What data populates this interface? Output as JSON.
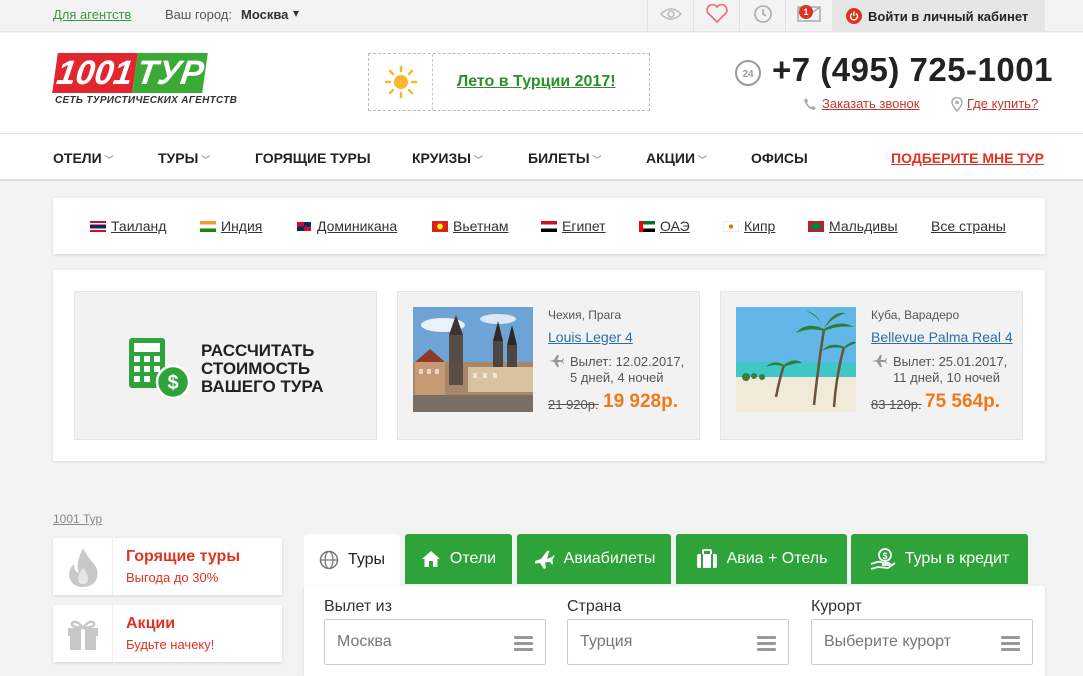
{
  "topbar": {
    "agency_link": "Для агентств",
    "city_label": "Ваш город:",
    "city": "Москва",
    "city_arrow": "▾",
    "messages_count": "1",
    "login": "Войти в личный кабинет"
  },
  "header": {
    "logo_main_1": "1001",
    "logo_main_2": "ТУР",
    "logo_sub": "СЕТЬ ТУРИСТИЧЕСКИХ АГЕНТСТВ",
    "promo": "Лето в Турции 2017!",
    "phone": "+7 (495) 725-1001",
    "callback": "Заказать звонок",
    "where_to_buy": "Где купить?"
  },
  "menu": {
    "items": [
      {
        "label": "ОТЕЛИ",
        "dropdown": true
      },
      {
        "label": "ТУРЫ",
        "dropdown": true
      },
      {
        "label": "ГОРЯЩИЕ ТУРЫ",
        "dropdown": false
      },
      {
        "label": "КРУИЗЫ",
        "dropdown": true
      },
      {
        "label": "БИЛЕТЫ",
        "dropdown": true
      },
      {
        "label": "АКЦИИ",
        "dropdown": true
      },
      {
        "label": "ОФИСЫ",
        "dropdown": false
      }
    ],
    "cta": "ПОДБЕРИТЕ МНЕ ТУР"
  },
  "countries": [
    {
      "label": "Таиланд",
      "flag": "flag-thailand-icon"
    },
    {
      "label": "Индия",
      "flag": "flag-india-icon"
    },
    {
      "label": "Доминикана",
      "flag": "flag-dominicana-icon"
    },
    {
      "label": "Вьетнам",
      "flag": "flag-vietnam-icon"
    },
    {
      "label": "Египет",
      "flag": "flag-egypt-icon"
    },
    {
      "label": "ОАЭ",
      "flag": "flag-uae-icon"
    },
    {
      "label": "Кипр",
      "flag": "flag-cyprus-icon"
    },
    {
      "label": "Мальдивы",
      "flag": "flag-maldives-icon"
    },
    {
      "label": "Все страны",
      "flag": ""
    }
  ],
  "calc": {
    "line1": "РАССЧИТАТЬ",
    "line2": "СТОИМОСТЬ",
    "line3": "ВАШЕГО ТУРА"
  },
  "tours": [
    {
      "location": "Чехия, Прага",
      "hotel": "Louis Leger 4",
      "departure": "Вылет: 12.02.2017,",
      "duration": "5 дней, 4 ночей",
      "old_price": "21 920р.",
      "price": "19 928р."
    },
    {
      "location": "Куба, Варадеро",
      "hotel": "Bellevue Palma Real 4",
      "departure": "Вылет: 25.01.2017,",
      "duration": "11 дней, 10 ночей",
      "old_price": "83 120р.",
      "price": "75 564р."
    }
  ],
  "breadcrumb": "1001 Тур",
  "side": [
    {
      "title": "Горящие туры",
      "subtitle": "Выгода до 30%"
    },
    {
      "title": "Акции",
      "subtitle": "Будьте начеку!"
    }
  ],
  "search": {
    "tabs": [
      "Туры",
      "Отели",
      "Авиабилеты",
      "Авиа + Отель",
      "Туры в кредит"
    ],
    "fields": [
      {
        "label": "Вылет из",
        "value": "Москва"
      },
      {
        "label": "Страна",
        "value": "Турция"
      },
      {
        "label": "Курорт",
        "value": "Выберите курорт"
      }
    ]
  },
  "colors": {
    "brand_green": "#2ea33a",
    "brand_red": "#e1262d",
    "price_orange": "#f07a1a",
    "link_blue": "#2b6fa8"
  }
}
